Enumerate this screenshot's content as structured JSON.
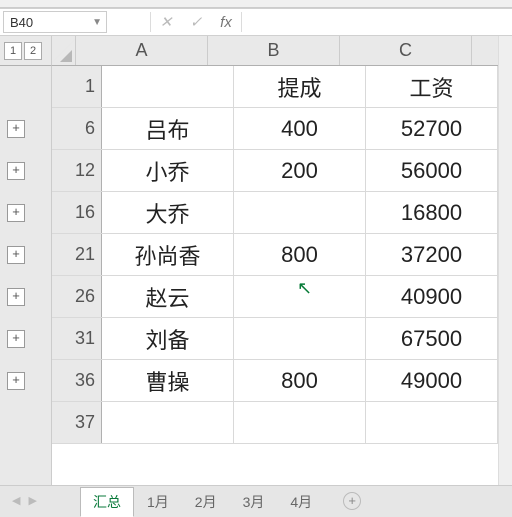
{
  "name_box": {
    "value": "B40"
  },
  "formula_bar": {
    "cancel": "✕",
    "enter": "✓",
    "fx": "fx",
    "value": ""
  },
  "outline_levels": [
    "1",
    "2"
  ],
  "columns": [
    "A",
    "B",
    "C"
  ],
  "rows": [
    {
      "num": "1",
      "a": "",
      "b": "提成",
      "c": "工资",
      "expand": null
    },
    {
      "num": "6",
      "a": "吕布",
      "b": "400",
      "c": "52700",
      "expand": "+"
    },
    {
      "num": "12",
      "a": "小乔",
      "b": "200",
      "c": "56000",
      "expand": "+"
    },
    {
      "num": "16",
      "a": "大乔",
      "b": "",
      "c": "16800",
      "expand": "+"
    },
    {
      "num": "21",
      "a": "孙尚香",
      "b": "800",
      "c": "37200",
      "expand": "+"
    },
    {
      "num": "26",
      "a": "赵云",
      "b": "",
      "c": "40900",
      "expand": "+"
    },
    {
      "num": "31",
      "a": "刘备",
      "b": "",
      "c": "67500",
      "expand": "+"
    },
    {
      "num": "36",
      "a": "曹操",
      "b": "800",
      "c": "49000",
      "expand": "+"
    },
    {
      "num": "37",
      "a": "",
      "b": "",
      "c": "",
      "expand": null
    }
  ],
  "sheets": {
    "active": "汇总",
    "tabs": [
      "汇总",
      "1月",
      "2月",
      "3月",
      "4月"
    ],
    "add": "+"
  },
  "nav": {
    "prev": "◀",
    "next": "▶"
  },
  "chart_data": {
    "type": "table",
    "title": "",
    "columns": [
      "",
      "提成",
      "工资"
    ],
    "rows": [
      [
        "吕布",
        400,
        52700
      ],
      [
        "小乔",
        200,
        56000
      ],
      [
        "大乔",
        null,
        16800
      ],
      [
        "孙尚香",
        800,
        37200
      ],
      [
        "赵云",
        null,
        40900
      ],
      [
        "刘备",
        null,
        67500
      ],
      [
        "曹操",
        800,
        49000
      ]
    ]
  }
}
